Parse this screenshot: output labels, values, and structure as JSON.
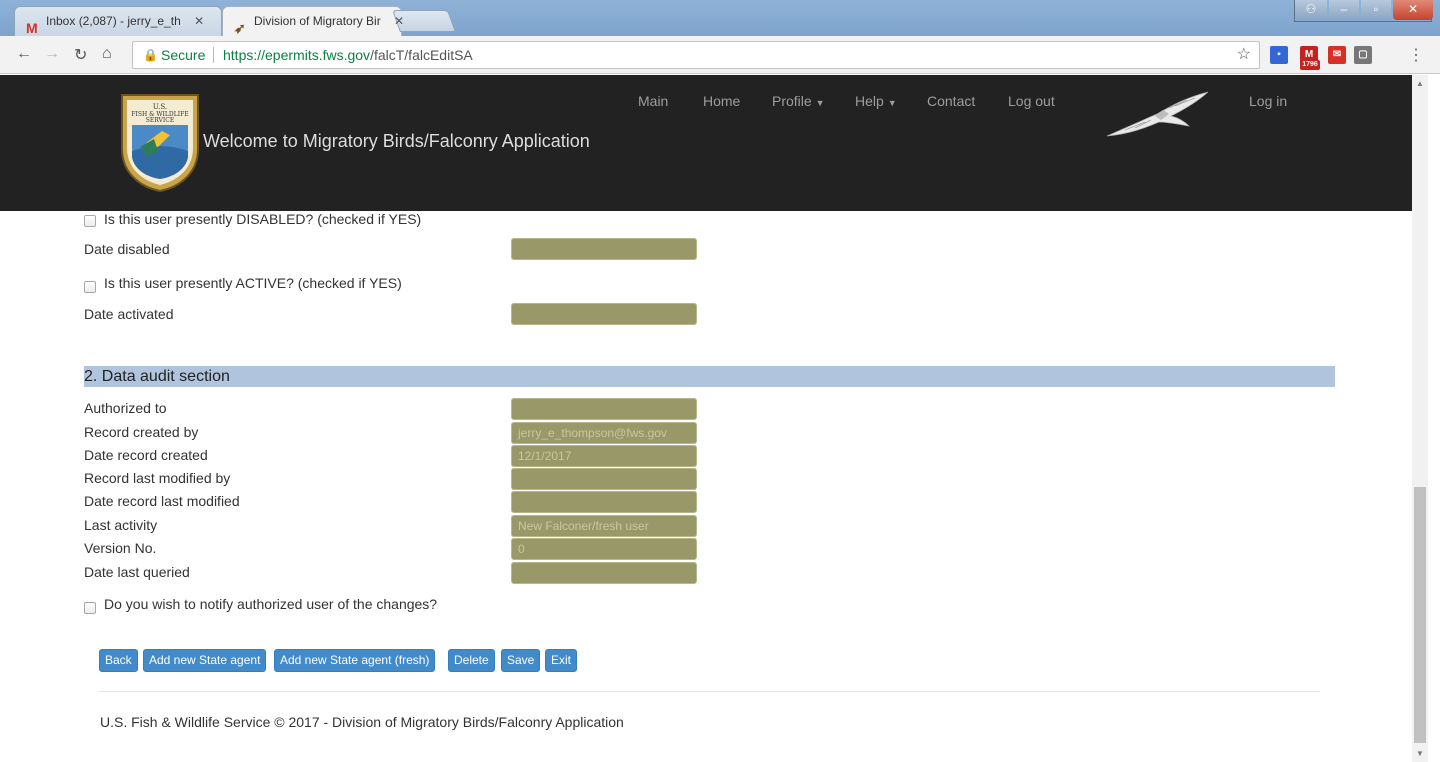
{
  "browser": {
    "tabs": [
      {
        "title": "Inbox (2,087) - jerry_e_th",
        "icon": "gmail-icon"
      },
      {
        "title": "Division of Migratory Bir",
        "icon": "hawk-favicon-icon"
      }
    ],
    "security_label": "Secure",
    "url_host": "https://epermits.fws.gov",
    "url_path": "/falcT/falcEditSA",
    "extension_badge": "1796"
  },
  "header": {
    "logo_text": "U.S. FISH & WILDLIFE SERVICE",
    "title": "Welcome to Migratory Birds/Falconry Application",
    "nav": {
      "main": "Main",
      "home": "Home",
      "profile": "Profile",
      "help": "Help",
      "contact": "Contact",
      "logout": "Log out",
      "login": "Log in"
    }
  },
  "status_section": {
    "disabled_question": "Is this user presently DISABLED? (checked if YES)",
    "date_disabled_label": "Date disabled",
    "date_disabled_value": "",
    "active_question": "Is this user presently ACTIVE? (checked if YES)",
    "date_activated_label": "Date activated",
    "date_activated_value": ""
  },
  "audit_section": {
    "title": "2. Data audit section",
    "rows": [
      {
        "label": "Authorized to",
        "value": ""
      },
      {
        "label": "Record created by",
        "value": "jerry_e_thompson@fws.gov"
      },
      {
        "label": "Date record created",
        "value": "12/1/2017"
      },
      {
        "label": "Record last modified by",
        "value": ""
      },
      {
        "label": "Date record last modified",
        "value": ""
      },
      {
        "label": "Last activity",
        "value": "New Falconer/fresh user"
      },
      {
        "label": "Version No.",
        "value": "0"
      },
      {
        "label": "Date last queried",
        "value": ""
      }
    ],
    "notify_question": "Do you wish to notify authorized user of the changes?"
  },
  "actions": {
    "back": "Back",
    "add_state_agent": "Add new State agent",
    "add_state_agent_fresh": "Add new State agent (fresh)",
    "delete": "Delete",
    "save": "Save",
    "exit": "Exit"
  },
  "footer": {
    "text": "U.S. Fish & Wildlife Service © 2017 - Division of Migratory Birds/Falconry Application"
  },
  "colors": {
    "header_bg": "#222222",
    "section_bar": "#b0c4de",
    "field_bg": "#989868",
    "button": "#428bca",
    "secure_green": "#0b8043"
  }
}
